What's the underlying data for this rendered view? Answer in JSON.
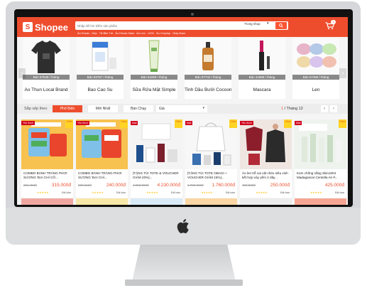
{
  "header": {
    "brand": "Shopee",
    "search_placeholder": "Nhập để tìm kiếm sản phẩm",
    "search_scope": "Trong shop",
    "cart_count": "1",
    "keywords": [
      "Áo Khoác",
      "Dép",
      "Tã Bỉm Trẻ",
      "Áo Khoác Nam",
      "Áo Len",
      "UGG",
      "Áo Croptop",
      "Giày Nam"
    ],
    "accent_color": "#ee4d2d"
  },
  "hero": {
    "items": [
      {
        "name": "Áo Thun Local Brand",
        "sales": "Bán 57548 / tháng",
        "icon": "tshirt"
      },
      {
        "name": "Bao Cao Su",
        "sales": "Bán 63767 / tháng",
        "icon": "box"
      },
      {
        "name": "Sữa Rửa Mặt Simple",
        "sales": "Bán 54259 / tháng",
        "icon": "tube"
      },
      {
        "name": "Tinh Dầu Bưởi Cocoon",
        "sales": "Bán 57742 / tháng",
        "icon": "bottle"
      },
      {
        "name": "Mascara",
        "sales": "Bán 42988 / tháng",
        "icon": "mascara"
      },
      {
        "name": "Len",
        "sales": "Bán 57486 / tháng",
        "icon": "yarn"
      }
    ]
  },
  "sort": {
    "label": "Sắp xếp theo",
    "options": [
      "Phổ Biến",
      "Mới Nhất",
      "Bán Chạy"
    ],
    "price_label": "Giá",
    "page_current": "1",
    "page_total": "/ Tháng 12"
  },
  "products": [
    {
      "name": "COMBO BÁNH TRÁNG PHƠI SƯƠNG 'ĐẠI CHỈ CỐ...",
      "old": "281.456đ",
      "price": "315.000đ",
      "sold": "Đã bán",
      "badge": "Yêu thích",
      "sale": "Giảm",
      "theme": "catsky"
    },
    {
      "name": "COMBO BÁNH TRÁNG PHƠI SƯƠNG 'ĐẠI CHỈ...",
      "old": "209.160đ",
      "price": "240.000đ",
      "sold": "Đã bán",
      "badge": "Yêu thích",
      "sale": "Giảm",
      "theme": "catsky"
    },
    {
      "name": "[TẶNG TÚI TOTE & VOUCHER GIẢM 20%]...",
      "old": "4.050.000đ",
      "price": "4.230.000đ",
      "sold": "Đã bán",
      "badge": "Mall",
      "sale": "Giảm",
      "theme": "obagi"
    },
    {
      "name": "[TẶNG TÚI TOTE OBAGI + VOUCHER GIẢM 15%]...",
      "old": "1.790.000đ",
      "price": "1.760.000đ",
      "sold": "Đã bán",
      "badge": "Mall",
      "sale": "Giảm",
      "theme": "obagi2"
    },
    {
      "name": "Áo len trễ vai cặt chéo siêu xinh kết hợp váy yếm 2 dây...",
      "old": "490.000đ",
      "price": "250.000đ",
      "sold": "Đã bán",
      "badge": "Yêu thích",
      "sale": "Giảm",
      "theme": "fashion"
    },
    {
      "name": "Kem chống nắng Skin1004 Madagascar Centella Air-F...",
      "old": "",
      "price": "425.000đ",
      "sold": "Đã bán",
      "badge": "Mall",
      "sale": "Giảm",
      "theme": "skin"
    }
  ]
}
